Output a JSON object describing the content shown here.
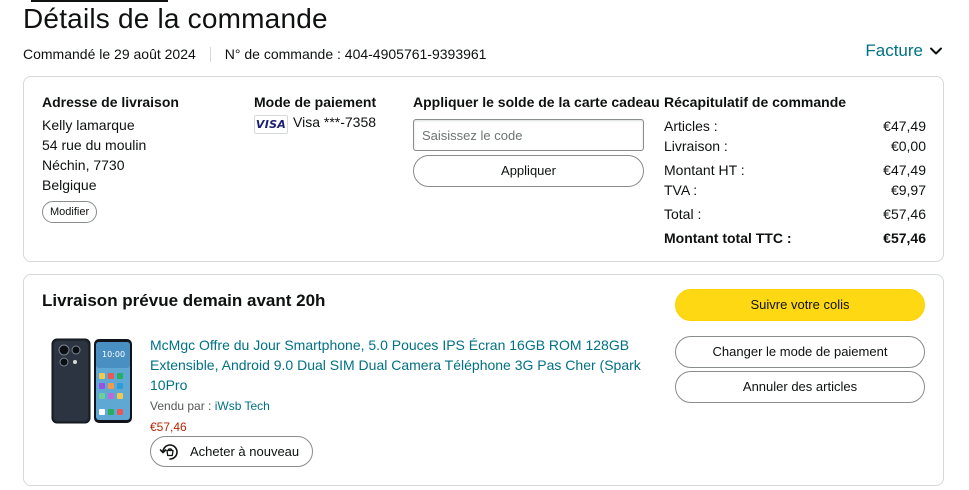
{
  "header": {
    "title": "Détails de la commande",
    "order_date": "Commandé le 29 août 2024",
    "order_number": "N° de commande : 404-4905761-9393961",
    "invoice_label": "Facture"
  },
  "shipping": {
    "title": "Adresse de livraison",
    "lines": [
      "Kelly lamarque",
      "54 rue du moulin",
      "Néchin, 7730",
      "Belgique"
    ],
    "edit_label": "Modifier"
  },
  "payment": {
    "title": "Mode de paiement",
    "card_logo": "VISA",
    "card_text": "Visa ***-7358"
  },
  "gift_card": {
    "title": "Appliquer le solde de la carte cadeau",
    "input_placeholder": "Saisissez le code",
    "input_value": "",
    "apply_label": "Appliquer"
  },
  "summary": {
    "title": "Récapitulatif de commande",
    "rows": [
      {
        "label": "Articles :",
        "value": "€47,49"
      },
      {
        "label": "Livraison :",
        "value": "€0,00"
      },
      {
        "label": "Montant HT :",
        "value": "€47,49"
      },
      {
        "label": "TVA :",
        "value": "€9,97"
      },
      {
        "label": "Total :",
        "value": "€57,46"
      },
      {
        "label": "Montant total TTC :",
        "value": "€57,46"
      }
    ]
  },
  "delivery": {
    "title": "Livraison prévue demain avant 20h",
    "track_label": "Suivre votre colis",
    "change_payment_label": "Changer le mode de paiement",
    "cancel_label": "Annuler des articles"
  },
  "product": {
    "title": "McMgc Offre du Jour Smartphone, 5.0 Pouces IPS Écran 16GB ROM 128GB Extensible, Android 9.0 Dual SIM Dual Camera Téléphone 3G Pas Cher (Spark 10Pro",
    "sold_by_label": "Vendu par : ",
    "seller": "iWsb Tech",
    "price": "€57,46",
    "buy_again_label": "Acheter à nouveau"
  },
  "colors": {
    "link": "#007185",
    "price": "#b12704",
    "primary_button": "#ffd814",
    "border": "#d5d9d9"
  }
}
